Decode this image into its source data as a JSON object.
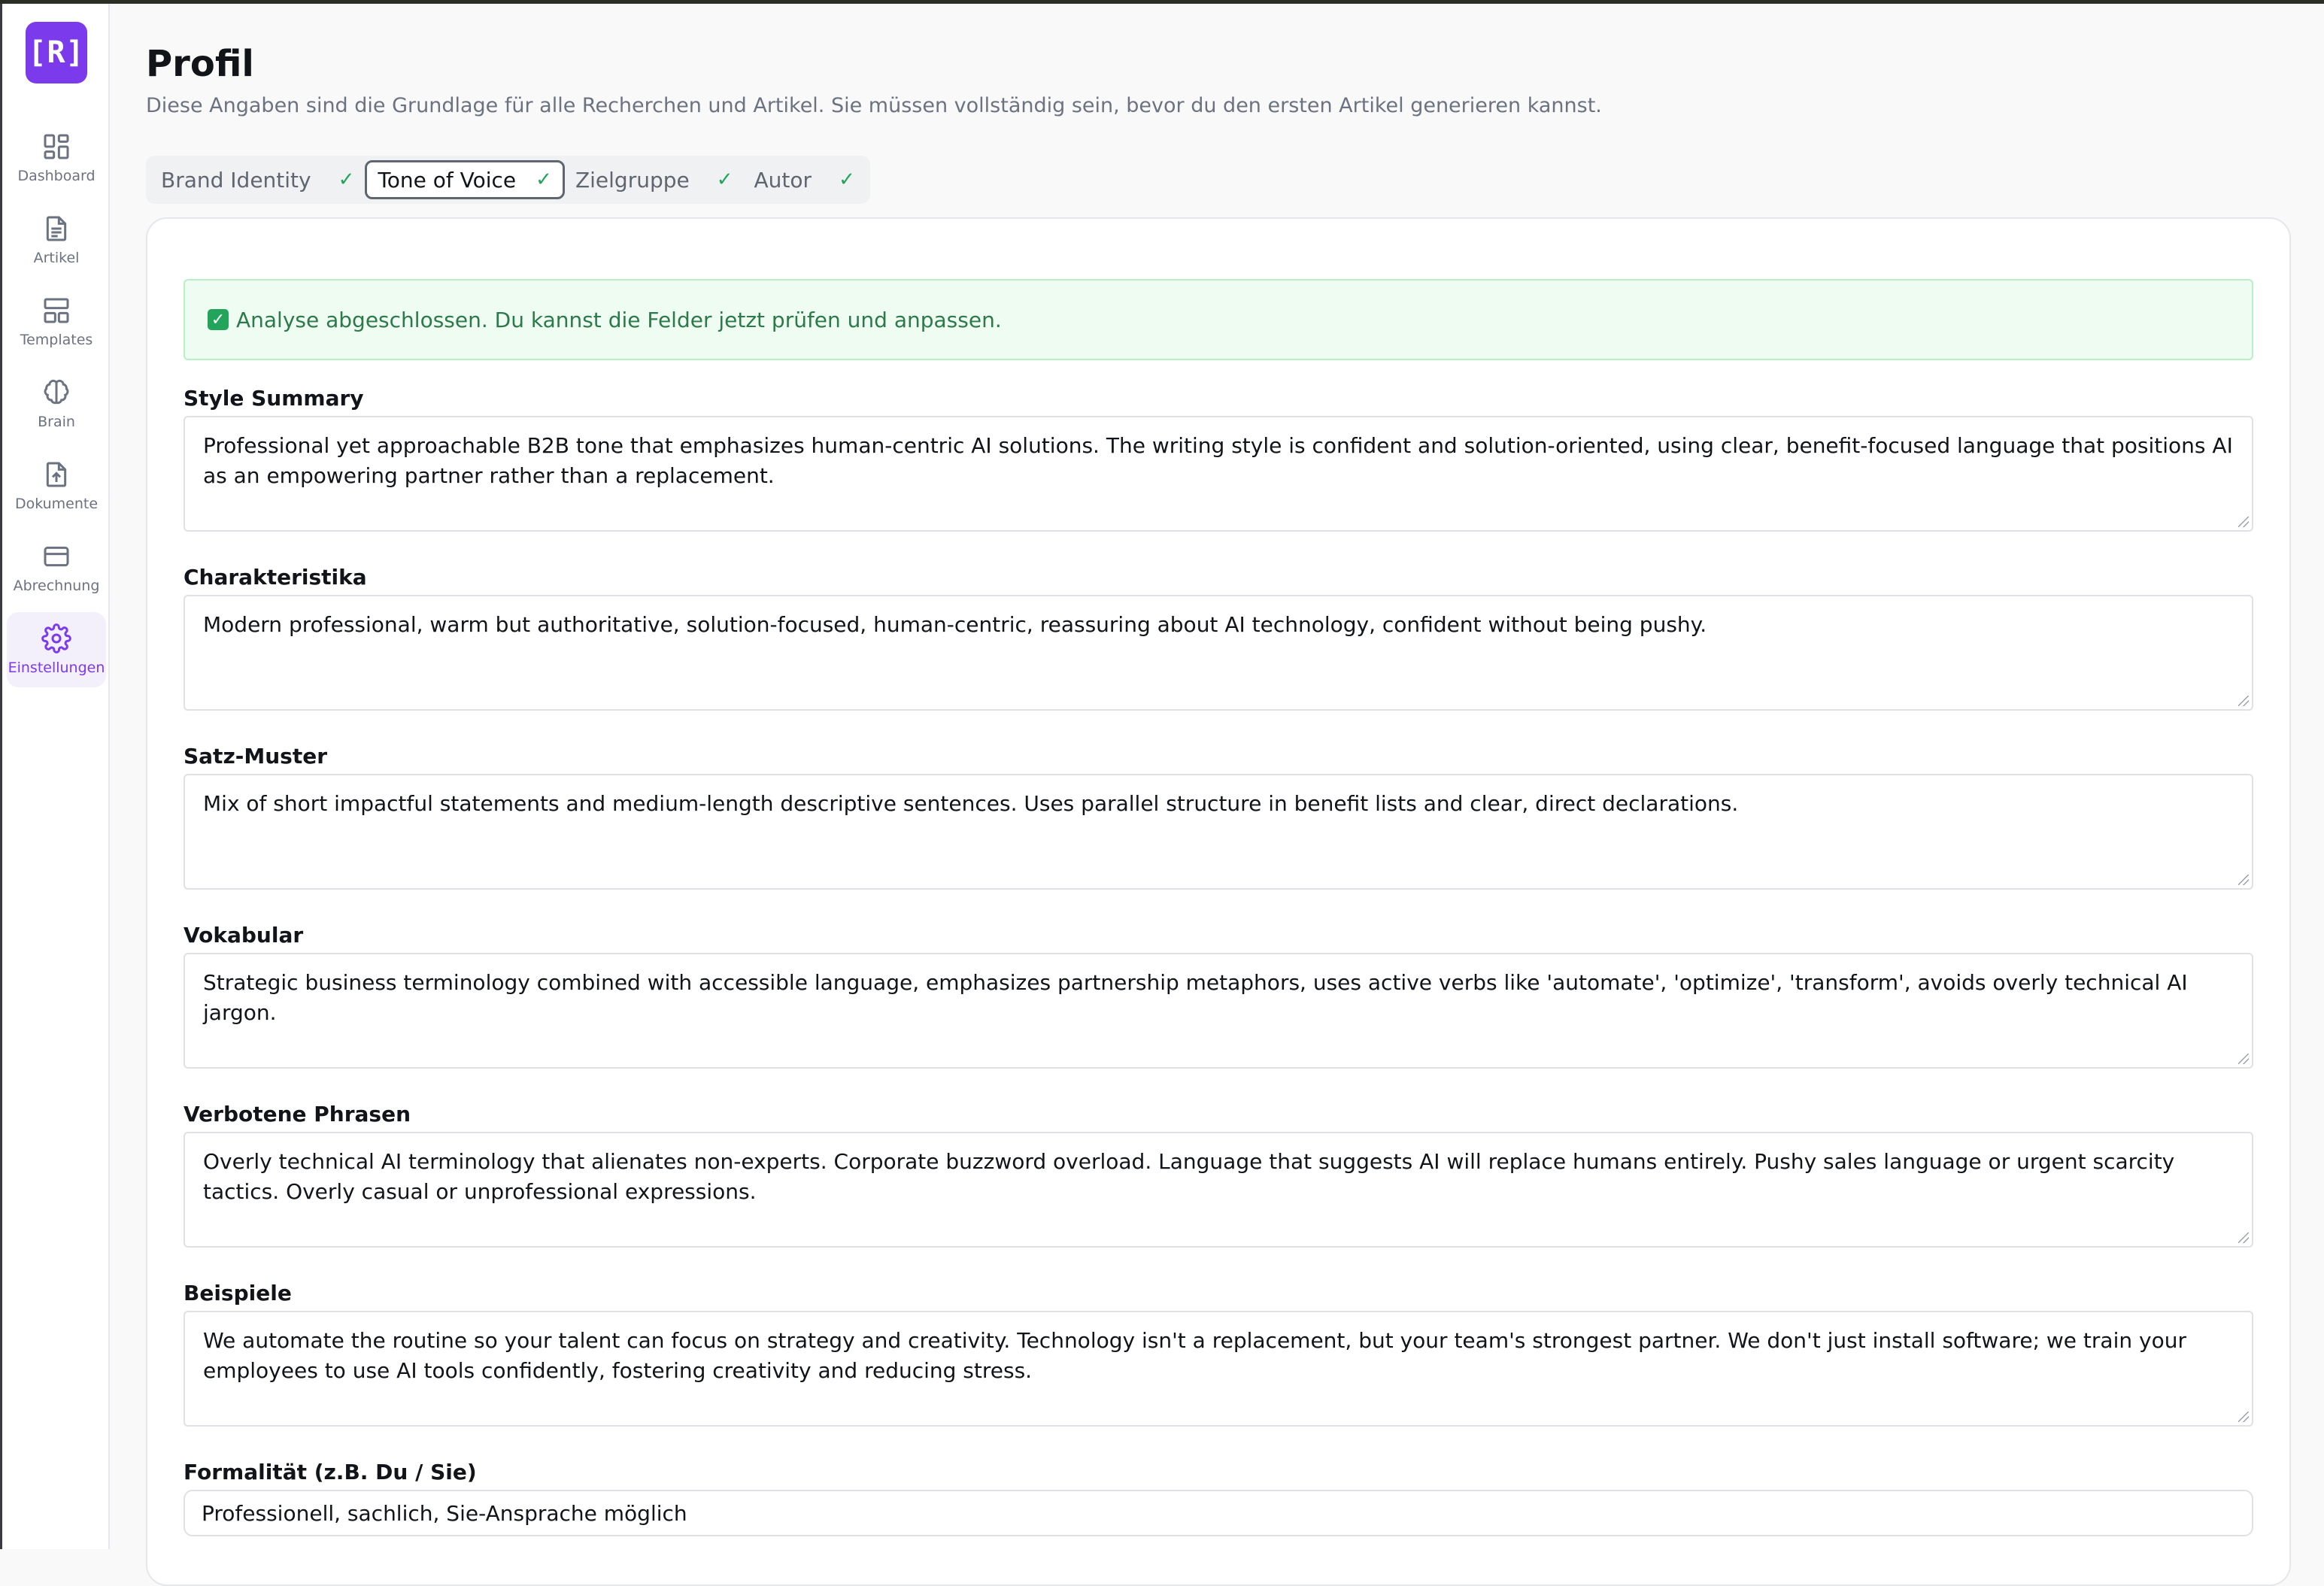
{
  "app": {
    "logo_text": "[R]"
  },
  "nav": [
    {
      "label": "Dashboard",
      "icon": "dashboard-icon"
    },
    {
      "label": "Artikel",
      "icon": "document-icon"
    },
    {
      "label": "Templates",
      "icon": "templates-icon"
    },
    {
      "label": "Brain",
      "icon": "brain-icon"
    },
    {
      "label": "Dokumente",
      "icon": "upload-file-icon"
    },
    {
      "label": "Abrechnung",
      "icon": "credit-card-icon"
    },
    {
      "label": "Einstellungen",
      "icon": "gear-icon",
      "active": true
    }
  ],
  "page": {
    "title": "Profil",
    "subtitle": "Diese Angaben sind die Grundlage für alle Recherchen und Artikel. Sie müssen vollständig sein, bevor du den ersten Artikel generieren kannst."
  },
  "tabs": [
    {
      "label": "Brand Identity",
      "check": "✓"
    },
    {
      "label": "Tone of Voice",
      "check": "✓",
      "active": true
    },
    {
      "label": "Zielgruppe",
      "check": "✓"
    },
    {
      "label": "Autor",
      "check": "✓"
    }
  ],
  "alert": {
    "icon": "✓",
    "text": "Analyse abgeschlossen. Du kannst die Felder jetzt prüfen und anpassen."
  },
  "fields": [
    {
      "label": "Style Summary",
      "value": "Professional yet approachable B2B tone that emphasizes human-centric AI solutions. The writing style is confident and solution-oriented, using clear, benefit-focused language that positions AI as an empowering partner rather than a replacement."
    },
    {
      "label": "Charakteristika",
      "value": "Modern professional, warm but authoritative, solution-focused, human-centric, reassuring about AI technology, confident without being pushy."
    },
    {
      "label": "Satz-Muster",
      "value": "Mix of short impactful statements and medium-length descriptive sentences. Uses parallel structure in benefit lists and clear, direct declarations."
    },
    {
      "label": "Vokabular",
      "value": "Strategic business terminology combined with accessible language, emphasizes partnership metaphors, uses active verbs like 'automate', 'optimize', 'transform', avoids overly technical AI jargon."
    },
    {
      "label": "Verbotene Phrasen",
      "value": "Overly technical AI terminology that alienates non-experts. Corporate buzzword overload. Language that suggests AI will replace humans entirely. Pushy sales language or urgent scarcity tactics. Overly casual or unprofessional expressions."
    },
    {
      "label": "Beispiele",
      "value": "We automate the routine so your talent can focus on strategy and creativity. Technology isn't a replacement, but your team's strongest partner. We don't just install software; we train your employees to use AI tools confidently, fostering creativity and reducing stress."
    }
  ],
  "formality": {
    "label": "Formalität (z.B. Du / Sie)",
    "value": "Professionell, sachlich, Sie-Ansprache möglich"
  },
  "colors": {
    "accent": "#7c3aed",
    "success": "#22a55b",
    "alert_bg": "#effcf2"
  }
}
